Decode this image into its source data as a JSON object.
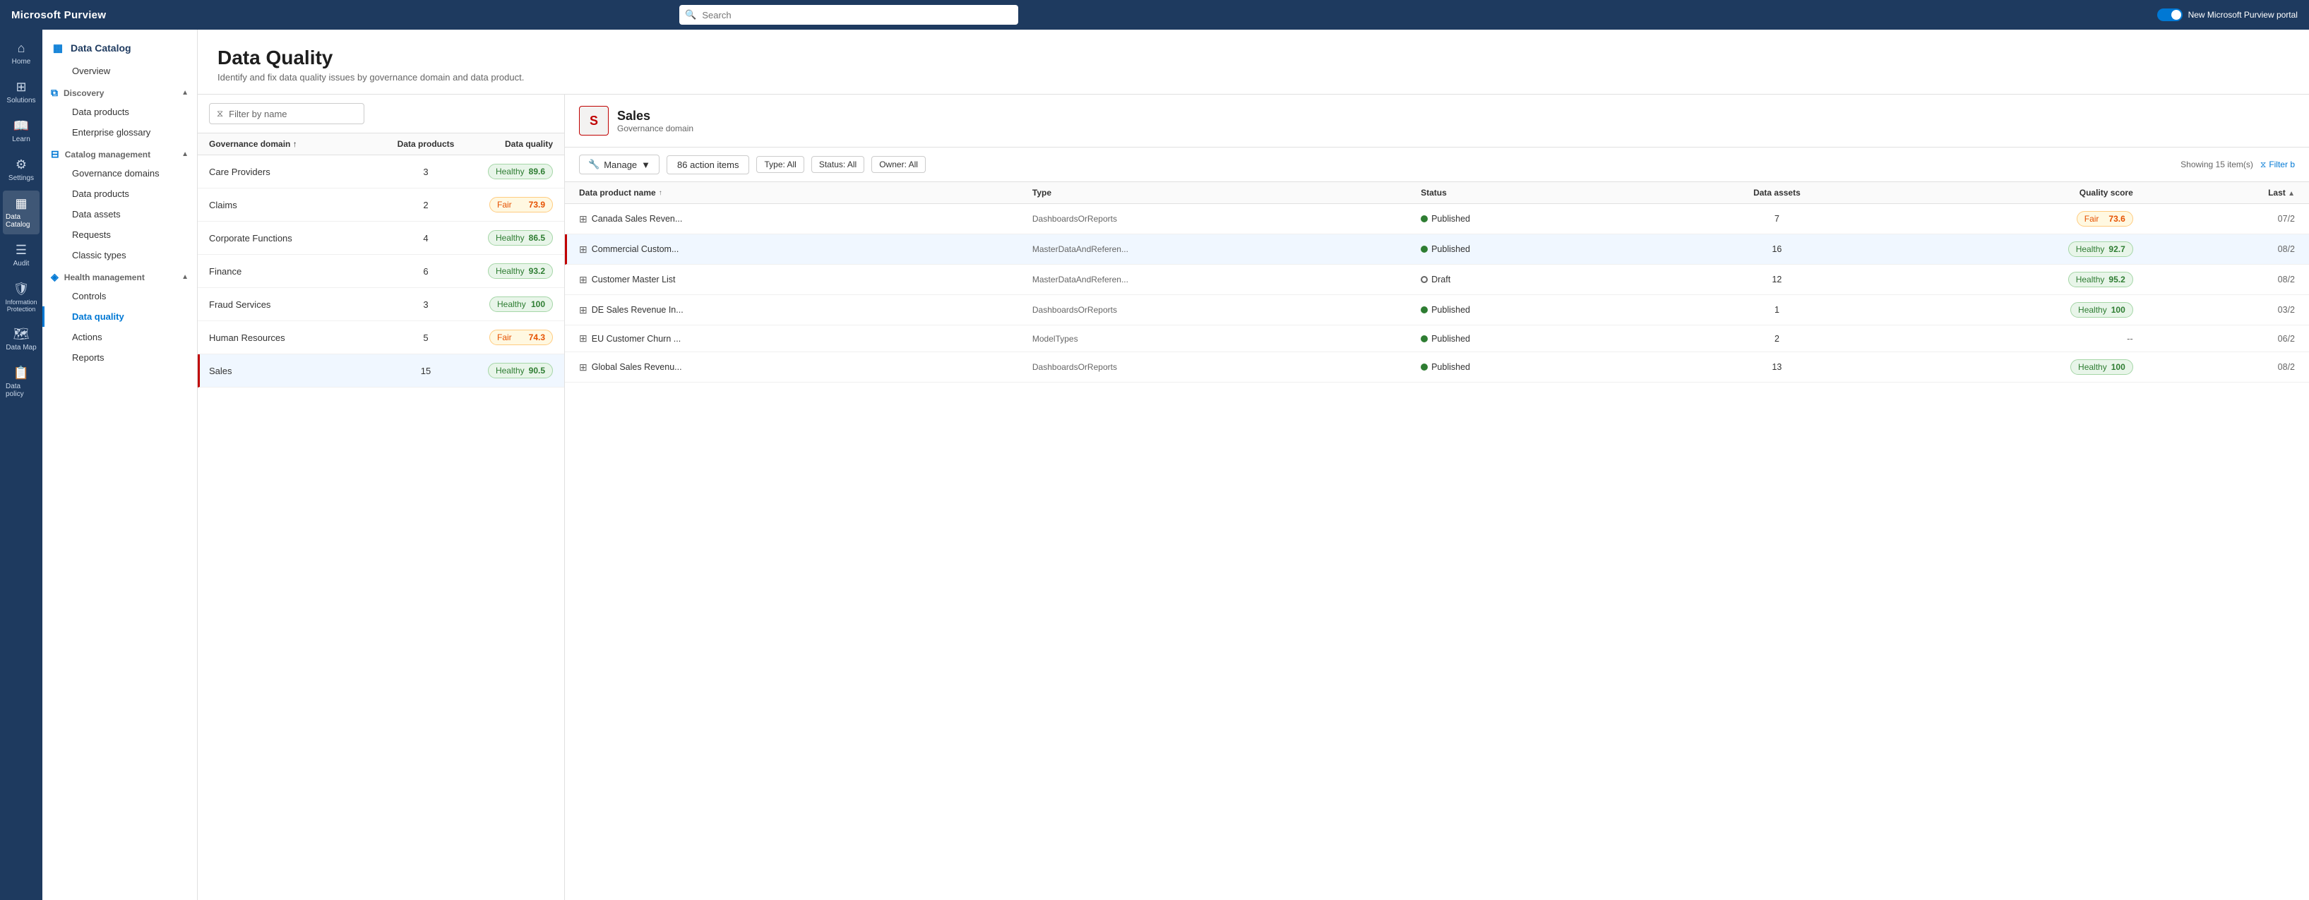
{
  "app": {
    "brand": "Microsoft Purview",
    "search_placeholder": "Search",
    "portal_toggle_label": "New Microsoft Purview portal"
  },
  "icon_sidebar": {
    "items": [
      {
        "id": "home",
        "label": "Home",
        "icon": "⌂"
      },
      {
        "id": "solutions",
        "label": "Solutions",
        "icon": "⊞"
      },
      {
        "id": "learn",
        "label": "Learn",
        "icon": "□"
      },
      {
        "id": "settings",
        "label": "Settings",
        "icon": "⚙"
      },
      {
        "id": "data-catalog",
        "label": "Data Catalog",
        "icon": "▦",
        "active": true
      },
      {
        "id": "audit",
        "label": "Audit",
        "icon": "☰"
      },
      {
        "id": "info-protection",
        "label": "Information Protection",
        "icon": "🛡"
      },
      {
        "id": "data-map",
        "label": "Data Map",
        "icon": "🗺"
      },
      {
        "id": "data-policy",
        "label": "Data policy",
        "icon": "📋"
      }
    ]
  },
  "nav_sidebar": {
    "catalog_title": "Data Catalog",
    "overview_label": "Overview",
    "discovery": {
      "label": "Discovery",
      "expanded": true,
      "items": [
        {
          "id": "data-products",
          "label": "Data products"
        },
        {
          "id": "enterprise-glossary",
          "label": "Enterprise glossary"
        }
      ]
    },
    "catalog_management": {
      "label": "Catalog management",
      "expanded": true,
      "items": [
        {
          "id": "governance-domains",
          "label": "Governance domains"
        },
        {
          "id": "data-products-mgmt",
          "label": "Data products"
        },
        {
          "id": "data-assets",
          "label": "Data assets"
        },
        {
          "id": "requests",
          "label": "Requests"
        },
        {
          "id": "classic-types",
          "label": "Classic types"
        }
      ]
    },
    "health_management": {
      "label": "Health management",
      "expanded": true,
      "items": [
        {
          "id": "controls",
          "label": "Controls"
        },
        {
          "id": "data-quality",
          "label": "Data quality",
          "active": true
        },
        {
          "id": "actions",
          "label": "Actions"
        },
        {
          "id": "reports",
          "label": "Reports"
        }
      ]
    }
  },
  "page": {
    "title": "Data Quality",
    "subtitle": "Identify and fix data quality issues by governance domain and data product."
  },
  "filter": {
    "placeholder": "Filter by name"
  },
  "table": {
    "columns": {
      "domain": "Governance domain",
      "products": "Data products",
      "quality": "Data quality"
    },
    "rows": [
      {
        "id": "care-providers",
        "name": "Care Providers",
        "products": 3,
        "status": "Healthy",
        "score": "89.6",
        "badge_type": "healthy"
      },
      {
        "id": "claims",
        "name": "Claims",
        "products": 2,
        "status": "Fair",
        "score": "73.9",
        "badge_type": "fair"
      },
      {
        "id": "corporate-functions",
        "name": "Corporate Functions",
        "products": 4,
        "status": "Healthy",
        "score": "86.5",
        "badge_type": "healthy"
      },
      {
        "id": "finance",
        "name": "Finance",
        "products": 6,
        "status": "Healthy",
        "score": "93.2",
        "badge_type": "healthy"
      },
      {
        "id": "fraud-services",
        "name": "Fraud Services",
        "products": 3,
        "status": "Healthy",
        "score": "100",
        "badge_type": "healthy"
      },
      {
        "id": "human-resources",
        "name": "Human Resources",
        "products": 5,
        "status": "Fair",
        "score": "74.3",
        "badge_type": "fair"
      },
      {
        "id": "sales",
        "name": "Sales",
        "products": 15,
        "status": "Healthy",
        "score": "90.5",
        "badge_type": "healthy",
        "selected": true
      }
    ]
  },
  "detail": {
    "domain_initial": "S",
    "domain_name": "Sales",
    "domain_type": "Governance domain",
    "toolbar": {
      "manage_label": "Manage",
      "action_items_label": "86 action items",
      "type_filter": "Type: All",
      "status_filter": "Status: All",
      "owner_filter": "Owner: All",
      "showing": "Showing 15 item(s)",
      "filter_label": "Filter b"
    },
    "columns": {
      "name": "Data product name",
      "type": "Type",
      "status": "Status",
      "assets": "Data assets",
      "score": "Quality score",
      "last": "Last"
    },
    "rows": [
      {
        "id": "canada-sales-rev",
        "name": "Canada Sales Reven...",
        "type": "DashboardsOrReports",
        "status": "Published",
        "status_type": "published",
        "assets": 7,
        "badge_type": "fair",
        "score_label": "Fair",
        "score": "73.6",
        "last": "07/2",
        "selected": false
      },
      {
        "id": "commercial-custom",
        "name": "Commercial Custom...",
        "type": "MasterDataAndReferen...",
        "status": "Published",
        "status_type": "published",
        "assets": 16,
        "badge_type": "healthy",
        "score_label": "Healthy",
        "score": "92.7",
        "last": "08/2",
        "selected": true
      },
      {
        "id": "customer-master-list",
        "name": "Customer Master List",
        "type": "MasterDataAndReferen...",
        "status": "Draft",
        "status_type": "draft",
        "assets": 12,
        "badge_type": "healthy",
        "score_label": "Healthy",
        "score": "95.2",
        "last": "08/2",
        "selected": false
      },
      {
        "id": "de-sales-revenue",
        "name": "DE Sales Revenue In...",
        "type": "DashboardsOrReports",
        "status": "Published",
        "status_type": "published",
        "assets": 1,
        "badge_type": "healthy",
        "score_label": "Healthy",
        "score": "100",
        "last": "03/2",
        "selected": false
      },
      {
        "id": "eu-customer-churn",
        "name": "EU Customer Churn ...",
        "type": "ModelTypes",
        "status": "Published",
        "status_type": "published",
        "assets": 2,
        "badge_type": "none",
        "score_label": "--",
        "score": "",
        "last": "06/2",
        "selected": false
      },
      {
        "id": "global-sales-revenu",
        "name": "Global Sales Revenu...",
        "type": "DashboardsOrReports",
        "status": "Published",
        "status_type": "published",
        "assets": 13,
        "badge_type": "healthy",
        "score_label": "Healthy",
        "score": "100",
        "last": "08/2",
        "selected": false
      }
    ]
  }
}
